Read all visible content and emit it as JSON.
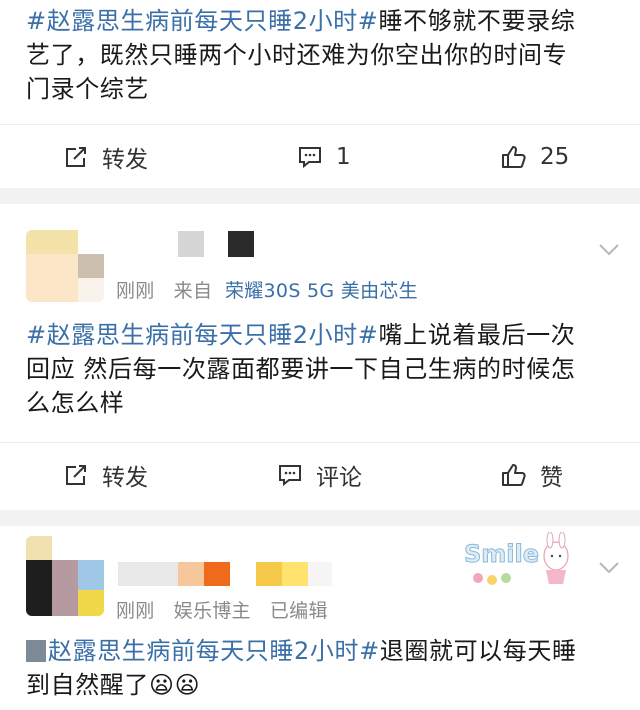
{
  "post1": {
    "hashtag": "#赵露思生病前每天只睡2小时#",
    "text_line1_rest": "睡不够就不要录综",
    "text_line2": "艺了，既然只睡两个小时还难为你空出你的时间专",
    "text_line3": "门录个综艺",
    "actions": {
      "repost": "转发",
      "comment": "1",
      "like": "25"
    }
  },
  "post2": {
    "meta_time": "刚刚",
    "meta_from": "来自",
    "meta_device": "荣耀30S 5G 美由芯生",
    "hashtag": "#赵露思生病前每天只睡2小时#",
    "text_line1_rest": "嘴上说着最后一次",
    "text_line2": "回应 然后每一次露面都要讲一下自己生病的时候怎",
    "text_line3": "么怎么样",
    "actions": {
      "repost": "转发",
      "comment": "评论",
      "like": "赞"
    }
  },
  "post3": {
    "meta_time": "刚刚",
    "meta_role": "娱乐博主",
    "meta_edited": "已编辑",
    "hashtag": "赵露思生病前每天只睡2小时#",
    "text_line1_rest": "退圈就可以每天睡",
    "text_line2": "到自然醒了",
    "emoji": "😦😦",
    "sticker_text": "Smile"
  },
  "colors": {
    "link": "#3a6fa8",
    "meta": "#8a8a8a",
    "separator": "#f2f2f2"
  },
  "icons": [
    "repost-icon",
    "comment-icon",
    "like-icon",
    "chevron-down-icon"
  ]
}
